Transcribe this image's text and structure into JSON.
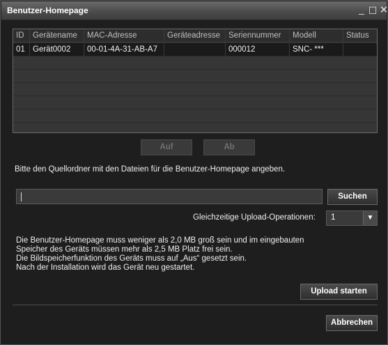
{
  "window": {
    "title": "Benutzer-Homepage",
    "controls": {
      "minimize": "_",
      "maximize": "☐",
      "close": "✕"
    }
  },
  "table": {
    "columns": [
      "ID",
      "Gerätename",
      "MAC-Adresse",
      "Geräteadresse",
      "Seriennummer",
      "Modell",
      "Status"
    ],
    "rows": [
      {
        "id": "01",
        "name": "Gerät0002",
        "mac": "00-01-4A-31-AB-A7",
        "address": "",
        "serial": "000012",
        "model": "SNC- ***",
        "status": ""
      }
    ],
    "empty_row_count": 6
  },
  "buttons": {
    "up": "Auf",
    "down": "Ab",
    "search": "Suchen",
    "upload": "Upload starten",
    "cancel": "Abbrechen"
  },
  "instructions": "Bitte den Quellordner mit den Dateien für die Benutzer-Homepage angeben.",
  "path_input": {
    "value": ""
  },
  "concurrent": {
    "label": "Gleichzeitige Upload-Operationen:",
    "value": "1"
  },
  "notes": [
    "Die Benutzer-Homepage muss weniger als 2,0 MB groß sein und im eingebauten",
    "Speicher des Geräts müssen mehr als 2,5 MB Platz frei sein.",
    "Die Bildspeicherfunktion des Geräts muss auf „Aus“ gesetzt sein.",
    "Nach der Installation wird das Gerät neu gestartet."
  ]
}
